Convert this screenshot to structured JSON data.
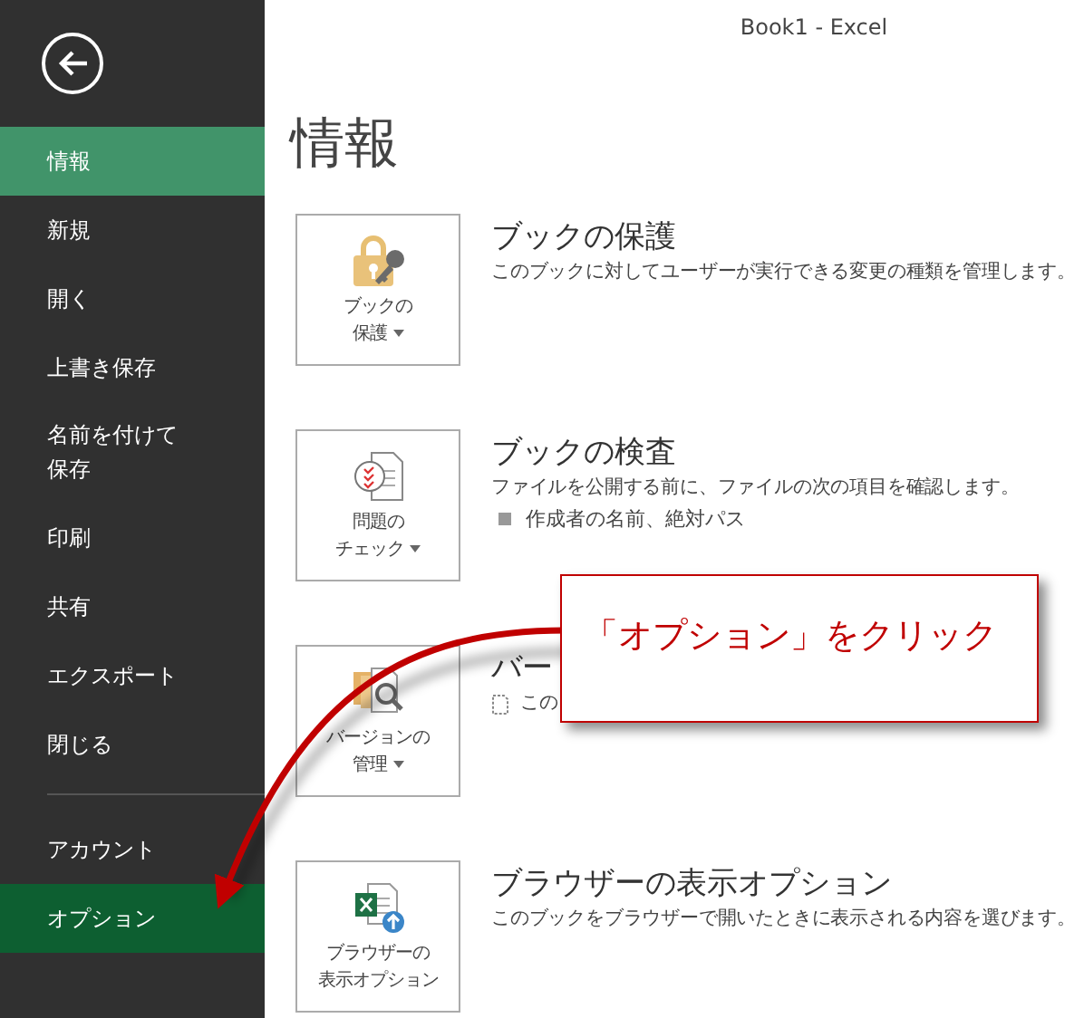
{
  "window": {
    "title": "Book1 - Excel"
  },
  "sidebar": {
    "groups": [
      [
        {
          "label": "情報",
          "selected": true,
          "highlighted": false
        },
        {
          "label": "新規",
          "selected": false,
          "highlighted": false
        },
        {
          "label": "開く",
          "selected": false,
          "highlighted": false
        },
        {
          "label": "上書き保存",
          "selected": false,
          "highlighted": false
        },
        {
          "label": "名前を付けて保存",
          "selected": false,
          "highlighted": false
        },
        {
          "label": "印刷",
          "selected": false,
          "highlighted": false
        },
        {
          "label": "共有",
          "selected": false,
          "highlighted": false
        },
        {
          "label": "エクスポート",
          "selected": false,
          "highlighted": false
        },
        {
          "label": "閉じる",
          "selected": false,
          "highlighted": false
        }
      ],
      [
        {
          "label": "アカウント",
          "selected": false,
          "highlighted": false
        },
        {
          "label": "オプション",
          "selected": false,
          "highlighted": true
        }
      ]
    ]
  },
  "page": {
    "heading": "情報",
    "sections": [
      {
        "kind": "protect",
        "tile_label": [
          "ブックの",
          "保護"
        ],
        "dropdown": true,
        "title": "ブックの保護",
        "description": "このブックに対してユーザーが実行できる変更の種類を管理します。"
      },
      {
        "kind": "inspect",
        "tile_label": [
          "問題の",
          "チェック"
        ],
        "dropdown": true,
        "title": "ブックの検査",
        "description": "ファイルを公開する前に、ファイルの次の項目を確認します。",
        "bullets": [
          "作成者の名前、絶対パス"
        ]
      },
      {
        "kind": "versions",
        "tile_label": [
          "バージョンの",
          "管理"
        ],
        "dropdown": true,
        "title": "バー",
        "description": "この",
        "note_icon": true
      },
      {
        "kind": "browser",
        "tile_label": [
          "ブラウザーの",
          "表示オプション"
        ],
        "dropdown": false,
        "title": "ブラウザーの表示オプション",
        "description": "このブックをブラウザーで開いたときに表示される内容を選びます。"
      }
    ]
  },
  "callout": {
    "text": "「オプション」をクリック"
  }
}
